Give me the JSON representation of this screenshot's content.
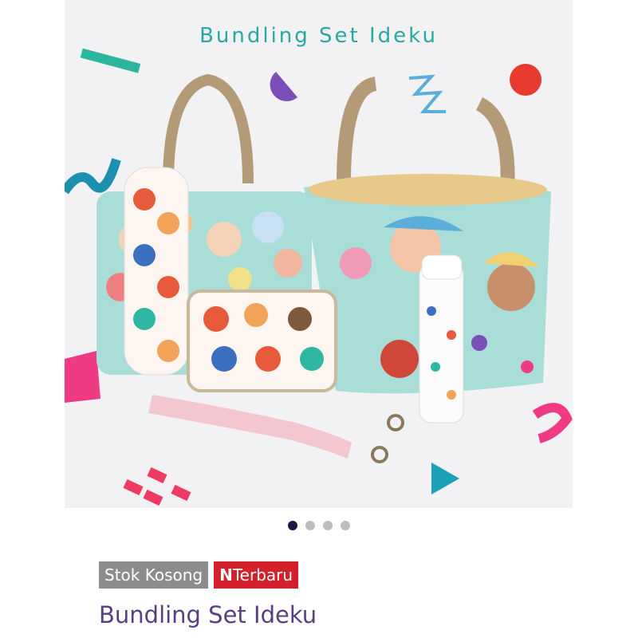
{
  "hero": {
    "title": "Bundling Set Ideku",
    "image_alt": "Bundling Set Ideku product photo"
  },
  "carousel": {
    "count": 4,
    "active_index": 0
  },
  "badges": {
    "stock": "Stok Kosong",
    "new_letter": "N",
    "new_label": "Terbaru"
  },
  "product": {
    "title": "Bundling Set Ideku"
  },
  "colors": {
    "title_purple": "#5a3f80",
    "stock_gray": "#8c8c8c",
    "new_red": "#d4202a",
    "dot_active": "#1f1645",
    "dot_inactive": "#bdbdbd"
  }
}
